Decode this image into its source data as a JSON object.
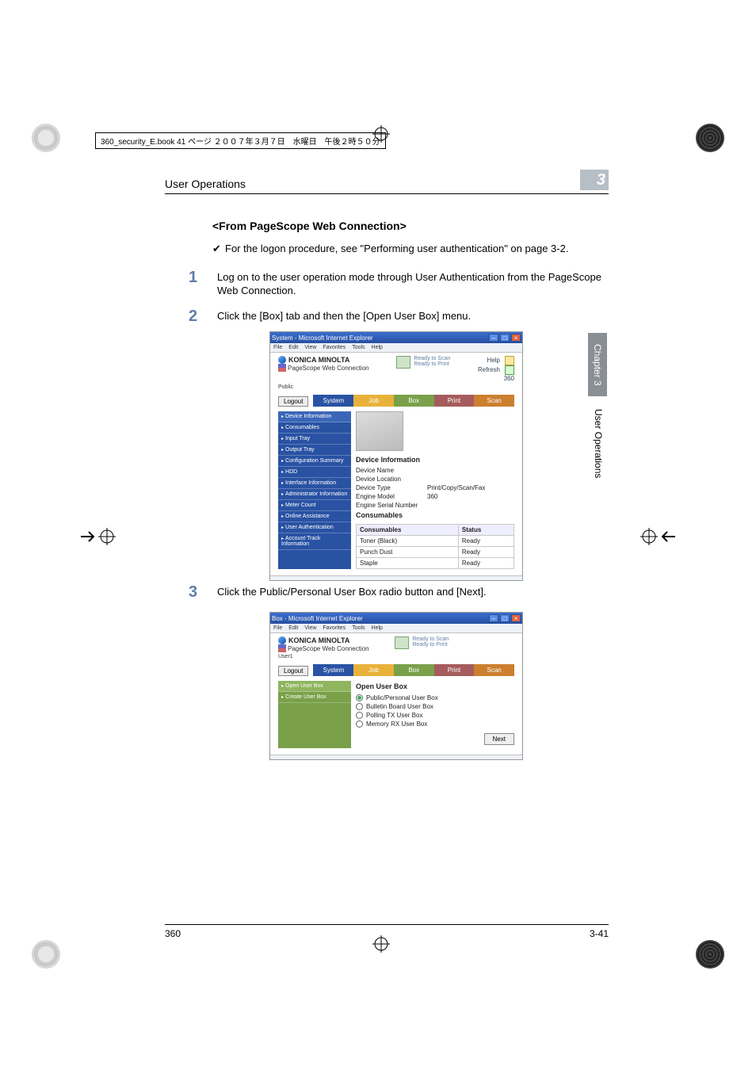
{
  "slug": "360_security_E.book  41 ページ  ２００７年３月７日　水曜日　午後２時５０分",
  "running_head": {
    "title": "User Operations",
    "chapter_number": "3"
  },
  "section_heading": "<From PageScope Web Connection>",
  "check_note": {
    "mark": "✔",
    "text": "For the logon procedure, see \"Performing user authentication\" on page 3-2."
  },
  "steps": [
    {
      "num": "1",
      "text": "Log on to the user operation mode through User Authentication from the PageScope Web Connection."
    },
    {
      "num": "2",
      "text": "Click the [Box] tab and then the [Open User Box] menu."
    },
    {
      "num": "3",
      "text": "Click the Public/Personal User Box radio button and [Next]."
    }
  ],
  "thumbtab": "Chapter 3",
  "sideminor": "User Operations",
  "footer": {
    "left": "360",
    "right": "3-41"
  },
  "shot1": {
    "window_title": "System - Microsoft Internet Explorer",
    "menubar": [
      "File",
      "Edit",
      "View",
      "Favorites",
      "Tools",
      "Help"
    ],
    "brand": "KONICA MINOLTA",
    "product": "PageScope Web Connection",
    "userline": "Public",
    "status": [
      "Ready to Scan",
      "Ready to Print"
    ],
    "rightlinks": {
      "help": "Help",
      "refresh": "Refresh",
      "model": "360"
    },
    "logout": "Logout",
    "tabs": {
      "system": "System",
      "job": "Job",
      "box": "Box",
      "print": "Print",
      "scan": "Scan"
    },
    "sidebar": [
      "Device Information",
      "Consumables",
      "Input Tray",
      "Output Tray",
      "Configuration Summary",
      "HDD",
      "Interface Information",
      "Administrator Information",
      "Meter Count",
      "Online Assistance",
      "User Authentication",
      "Account Track Information"
    ],
    "main": {
      "heading": "Device Information",
      "kv": [
        {
          "k": "Device Name",
          "v": ""
        },
        {
          "k": "Device Location",
          "v": ""
        },
        {
          "k": "Device Type",
          "v": "Print/Copy/Scan/Fax"
        },
        {
          "k": "Engine Model",
          "v": "360"
        },
        {
          "k": "Engine Serial Number",
          "v": ""
        }
      ],
      "subheading": "Consumables",
      "table": {
        "headers": [
          "Consumables",
          "Status"
        ],
        "rows": [
          [
            "Toner (Black)",
            "Ready"
          ],
          [
            "Punch Dust",
            "Ready"
          ],
          [
            "Staple",
            "Ready"
          ]
        ]
      }
    }
  },
  "shot2": {
    "window_title": "Box - Microsoft Internet Explorer",
    "menubar": [
      "File",
      "Edit",
      "View",
      "Favorites",
      "Tools",
      "Help"
    ],
    "brand": "KONICA MINOLTA",
    "product": "PageScope Web Connection",
    "userline": "User1",
    "status": [
      "Ready to Scan",
      "Ready to Print"
    ],
    "logout": "Logout",
    "tabs": {
      "system": "System",
      "job": "Job",
      "box": "Box",
      "print": "Print",
      "scan": "Scan"
    },
    "sidebar": [
      "Open User Box",
      "Create User Box"
    ],
    "main": {
      "heading": "Open User Box",
      "options": [
        "Public/Personal User Box",
        "Bulletin Board User Box",
        "Polling TX User Box",
        "Memory RX User Box"
      ],
      "next": "Next"
    }
  }
}
